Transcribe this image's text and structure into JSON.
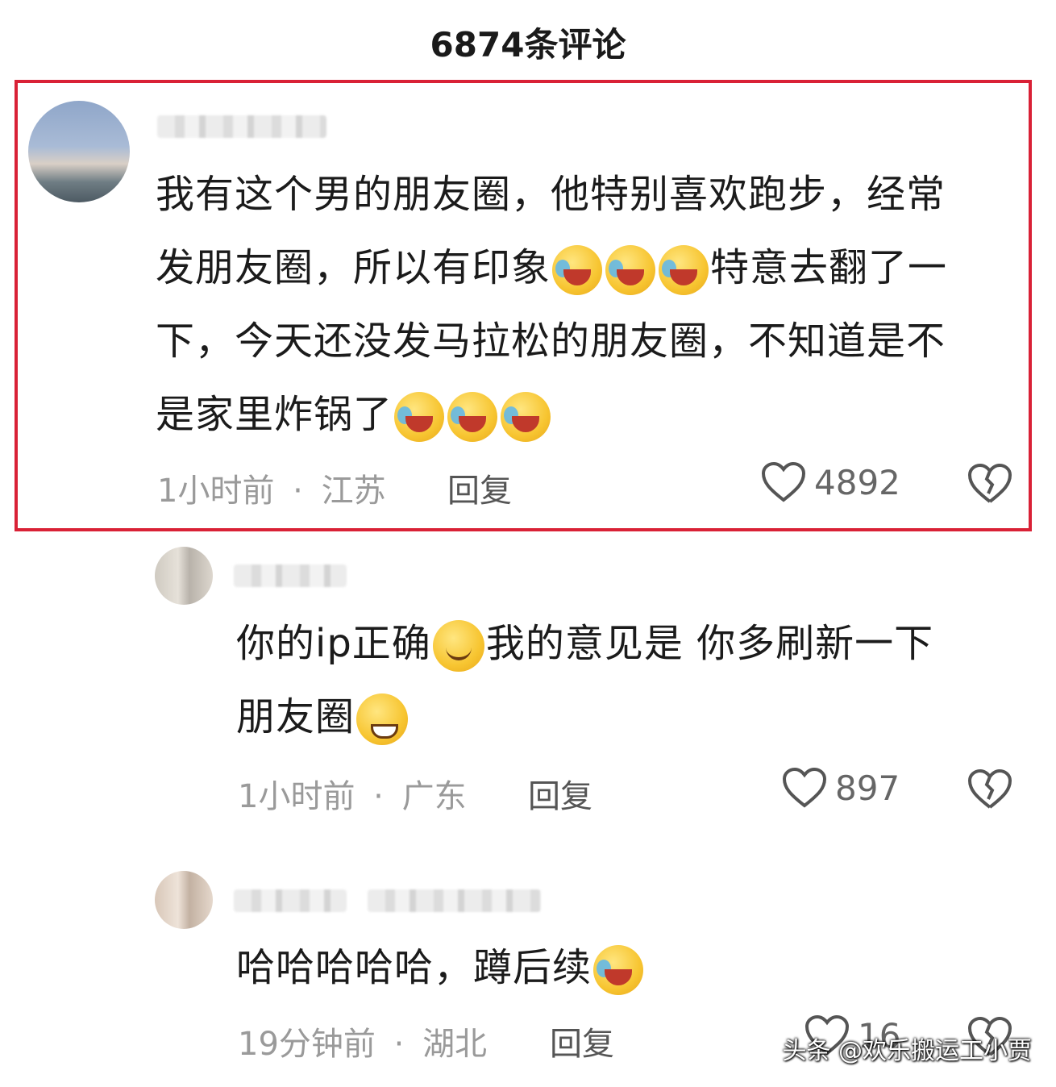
{
  "header": {
    "title": "6874条评论"
  },
  "comments": [
    {
      "text_lines": [
        "我有这个男的朋友圈，他特别喜欢跑步，经常",
        "发朋友圈，所以有印象",
        "特意去翻了一",
        "下，今天还没发马拉松的朋友圈，不知道是不",
        "是家里炸锅了"
      ],
      "time": "1小时前",
      "region": "江苏",
      "reply_label": "回复",
      "likes": "4892",
      "highlight_color": "#d92136"
    },
    {
      "text_lines": [
        "你的ip正确",
        "我的意见是 你多刷新一下",
        "朋友圈"
      ],
      "time": "1小时前",
      "region": "广东",
      "reply_label": "回复",
      "likes": "897"
    },
    {
      "text_lines": [
        "哈哈哈哈哈，蹲后续"
      ],
      "time": "19分钟前",
      "region": "湖北",
      "reply_label": "回复",
      "likes": "16"
    }
  ],
  "separator": "·",
  "watermark": "头条 @欢乐搬运工小贾"
}
